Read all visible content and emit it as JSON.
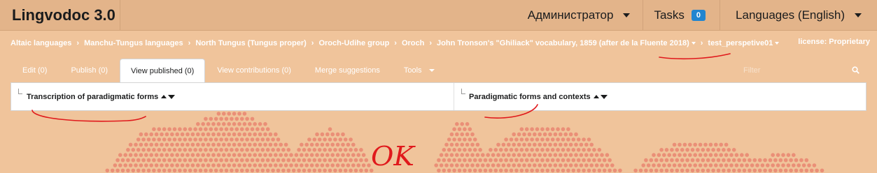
{
  "header": {
    "app_title": "Lingvodoc 3.0",
    "user_menu": "Администратор",
    "tasks_label": "Tasks",
    "tasks_count": "0",
    "languages_menu": "Languages (English)"
  },
  "breadcrumb": {
    "items": [
      "Altaic languages",
      "Manchu-Tungus languages",
      "North Tungus (Tungus proper)",
      "Oroch-Udihe group",
      "Oroch",
      "John Tronson's \"Ghiliack\" vocabulary, 1859 (after de la Fluente 2018)",
      "test_perspetive01"
    ],
    "license": "license: Proprietary"
  },
  "tabs": {
    "edit": "Edit (0)",
    "publish": "Publish (0)",
    "view_published": "View published (0)",
    "view_contributions": "View contributions (0)",
    "merge_suggestions": "Merge suggestions",
    "tools": "Tools",
    "filter_placeholder": "Filter"
  },
  "table": {
    "columns": [
      "Transcription of paradigmatic forms",
      "Paradigmatic forms and contexts"
    ]
  },
  "annotation": {
    "handwritten_text": "OK",
    "ink_color": "#e0191c"
  },
  "colors": {
    "background": "#f0c49b",
    "topbar": "#e3b48a",
    "badge": "#2185d0",
    "dots": "#ea8f77"
  }
}
